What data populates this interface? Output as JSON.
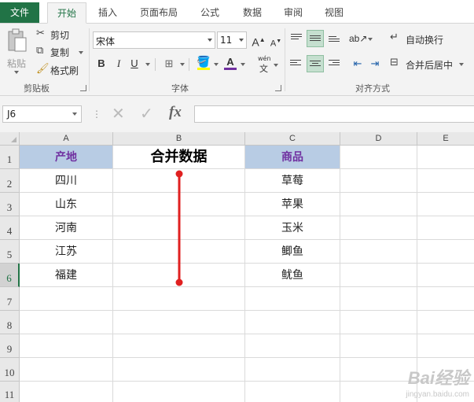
{
  "ribbon_tabs": [
    "文件",
    "开始",
    "插入",
    "页面布局",
    "公式",
    "数据",
    "审阅",
    "视图"
  ],
  "clipboard": {
    "paste": "粘贴",
    "cut": "剪切",
    "copy": "复制",
    "format_painter": "格式刷",
    "group_label": "剪贴板"
  },
  "font": {
    "name": "宋体",
    "size": "11",
    "bold": "B",
    "italic": "I",
    "underline": "U",
    "phonetic": "wén",
    "group_label": "字体"
  },
  "alignment": {
    "wrap_text": "自动换行",
    "merge_center": "合并后居中",
    "group_label": "对齐方式"
  },
  "formula_bar": {
    "name_box": "J6",
    "fx_label": "fx",
    "formula": ""
  },
  "columns": [
    "A",
    "B",
    "C",
    "D",
    "E"
  ],
  "rows": [
    "1",
    "2",
    "3",
    "4",
    "5",
    "6",
    "7",
    "8",
    "9",
    "10",
    "11"
  ],
  "cells": {
    "a1": "产地",
    "b1": "合并数据",
    "c1": "商品",
    "col_a": [
      "四川",
      "山东",
      "河南",
      "江苏",
      "福建"
    ],
    "col_c": [
      "草莓",
      "苹果",
      "玉米",
      "鲫鱼",
      "鱿鱼"
    ]
  },
  "colors": {
    "accent": "#217346",
    "header_fill": "#b8cce4",
    "header_text": "#7030a0",
    "annotation": "#e02020"
  },
  "watermark": {
    "brand": "Bai经验",
    "url": "jingyan.baidu.com"
  }
}
